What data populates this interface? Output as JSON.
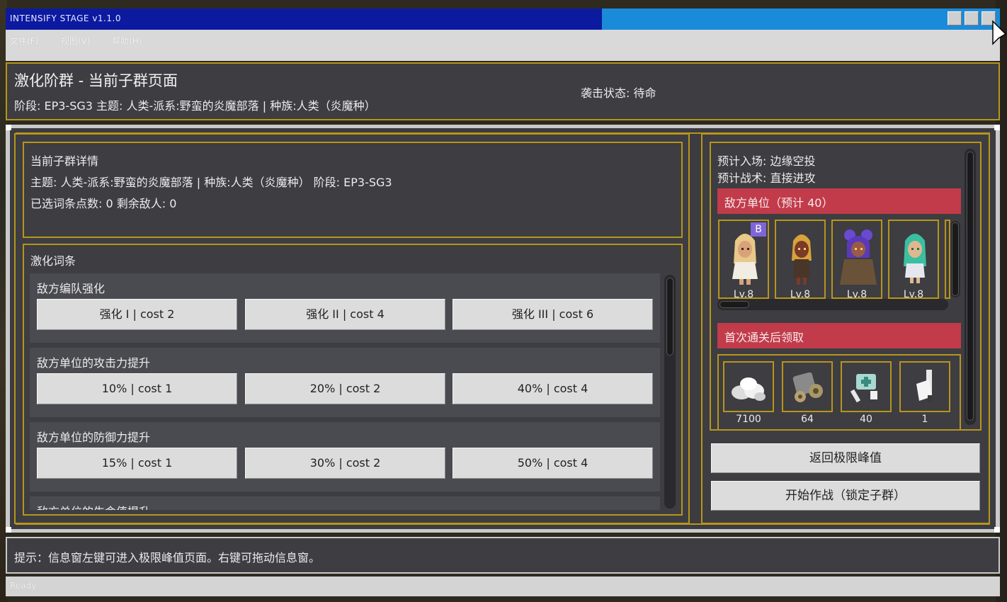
{
  "window": {
    "title": "INTENSIFY STAGE v1.1.0",
    "buttons": [
      "minimize",
      "maximize",
      "close"
    ]
  },
  "menu": {
    "items": [
      "文件(F)",
      "视图(V)",
      "帮助(H)"
    ]
  },
  "header": {
    "title": "激化阶群 - 当前子群页面",
    "subtitle": "阶段: EP3-SG3 主题: 人类-派系:野蛮的炎魔部落 | 种族:人类（炎魔种）",
    "status": "袭击状态: 待命"
  },
  "details": {
    "title": "当前子群详情",
    "line1": "主题: 人类-派系:野蛮的炎魔部落 | 种族:人类（炎魔种） 阶段: EP3-SG3",
    "line2": "已选词条点数: 0 剩余敌人: 0"
  },
  "modifiers": {
    "title": "激化词条",
    "groups": [
      {
        "name": "敌方编队强化",
        "options": [
          "强化 I | cost 2",
          "强化 II | cost 4",
          "强化 III | cost 6"
        ]
      },
      {
        "name": "敌方单位的攻击力提升",
        "options": [
          "10% | cost 1",
          "20% | cost 2",
          "40% | cost 4"
        ]
      },
      {
        "name": "敌方单位的防御力提升",
        "options": [
          "15% | cost 1",
          "30% | cost 2",
          "50% | cost 4"
        ]
      },
      {
        "name": "敌方单位的生命值提升",
        "options": []
      }
    ]
  },
  "intel": {
    "entry": "预计入场: 边缘空投",
    "tactic": "预计战术: 直接进攻",
    "enemy_header": "敌方单位（预计 40）",
    "units": [
      {
        "level": "Lv.8",
        "badge": "B",
        "portrait": "blonde-girl-portrait-icon"
      },
      {
        "level": "Lv.8",
        "badge": "",
        "portrait": "dark-skin-girl-portrait-icon"
      },
      {
        "level": "Lv.8",
        "badge": "",
        "portrait": "purple-hair-girl-portrait-icon"
      },
      {
        "level": "Lv.8",
        "badge": "",
        "portrait": "green-hair-girl-portrait-icon"
      }
    ],
    "reward_header": "首次通关后领取",
    "rewards": [
      {
        "count": "7100",
        "icon": "silver-pile-icon"
      },
      {
        "count": "64",
        "icon": "components-icon"
      },
      {
        "count": "40",
        "icon": "medicine-kit-icon"
      },
      {
        "count": "1",
        "icon": "injector-icon"
      }
    ]
  },
  "actions": {
    "back": "返回极限峰值",
    "start": "开始作战（锁定子群）"
  },
  "footer": {
    "hint": "提示：信息窗左键可进入极限峰值页面。右键可拖动信息窗。",
    "status": "Ready"
  },
  "colors": {
    "title_bar_left": "#0c1aa0",
    "title_bar_right": "#1a8bd9",
    "panel_bg": "#3d3d42",
    "gold_border": "#b8951a",
    "red_header": "#c23b4a",
    "badge": "#7f66d8"
  }
}
